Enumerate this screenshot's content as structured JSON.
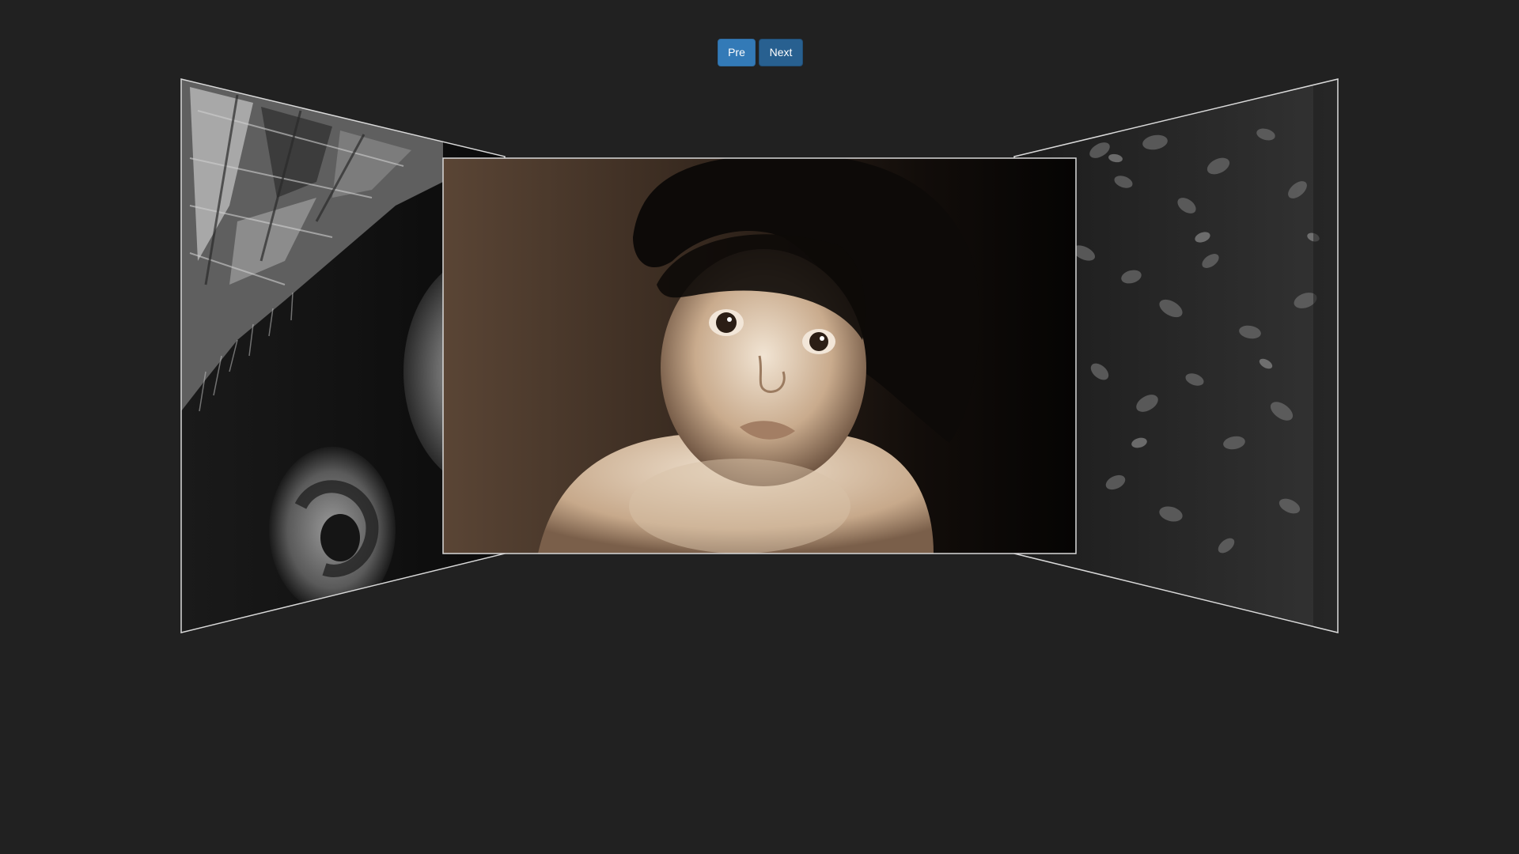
{
  "controls": {
    "pre_label": "Pre",
    "next_label": "Next"
  },
  "colors": {
    "background": "#212121",
    "button_primary": "#337ab7",
    "button_active": "#286090",
    "frame_border": "#d9d9d9"
  },
  "gallery": {
    "slides": [
      {
        "position": "left",
        "description_icon": "photo-hat-ear"
      },
      {
        "position": "center",
        "description_icon": "photo-baby-in-hat",
        "active": true
      },
      {
        "position": "right",
        "description_icon": "photo-leaves"
      }
    ]
  }
}
